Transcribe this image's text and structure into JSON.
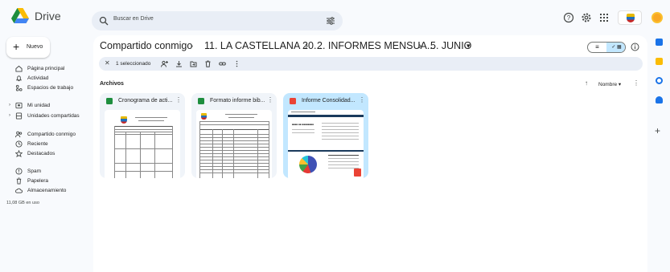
{
  "app": {
    "brand": "Drive"
  },
  "search": {
    "placeholder": "Buscar en Drive"
  },
  "sidebar": {
    "new_label": "Nuevo",
    "items": [
      {
        "label": "Página principal"
      },
      {
        "label": "Actividad"
      },
      {
        "label": "Espacios de trabajo"
      },
      {
        "label": "Mi unidad"
      },
      {
        "label": "Unidades compartidas"
      },
      {
        "label": "Compartido conmigo"
      },
      {
        "label": "Reciente"
      },
      {
        "label": "Destacados"
      },
      {
        "label": "Spam"
      },
      {
        "label": "Papelera"
      },
      {
        "label": "Almacenamiento"
      }
    ],
    "storage_used": "11,08 GB en uso"
  },
  "breadcrumb": {
    "items": [
      "Compartido conmigo",
      "11. LA CASTELLANA 20...",
      "2. INFORMES MENSUA...",
      "5. JUNIO"
    ],
    "separator": "›",
    "dropdown": "▾"
  },
  "selection": {
    "count_label": "1 seleccionado"
  },
  "files": {
    "section_title": "Archivos",
    "sort_label": "Nombre",
    "cards": [
      {
        "title": "Cronograma de acti...",
        "type": "sheet",
        "selected": false
      },
      {
        "title": "Formato informe bib...",
        "type": "sheet",
        "selected": false
      },
      {
        "title": "Informe Consolidad...",
        "type": "pdf",
        "selected": true
      }
    ]
  },
  "colors": {
    "accent": "#0b57d0",
    "selected": "#c2e7ff",
    "sheet": "#1e8e3e",
    "pdf": "#ea4335"
  }
}
